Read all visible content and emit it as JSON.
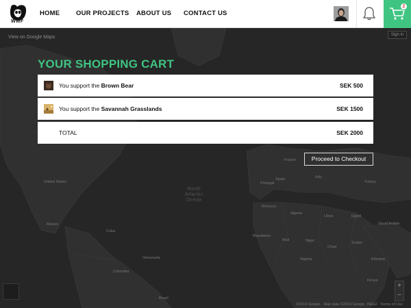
{
  "header": {
    "logo_text": "WWF",
    "nav": [
      {
        "label": "HOME"
      },
      {
        "label": "OUR PROJECTS"
      },
      {
        "label": "ABOUT US"
      },
      {
        "label": "CONTACT US"
      }
    ],
    "cart_count": "2"
  },
  "map": {
    "google_maps_link": "View on Google Maps",
    "sign_in": "Sign in",
    "ocean_label": "North\nAtlantic\nOcean",
    "labels": [
      "United States",
      "Mexico",
      "Cuba",
      "Venezuela",
      "Colombia",
      "Brazil",
      "Portugal",
      "Spain",
      "France",
      "Italy",
      "Turkey",
      "Morocco",
      "Algeria",
      "Libya",
      "Egypt",
      "Saudi Arabia",
      "Mali",
      "Niger",
      "Chad",
      "Sudan",
      "Nigeria",
      "Ethiopia",
      "Kenya",
      "Mauritania"
    ],
    "copyright": "©2014 Google · Map data ©2014 Google, INEGI · Terms of Use",
    "zoom_in": "+",
    "zoom_out": "−"
  },
  "cart": {
    "title": "YOUR SHOPPING CART",
    "items": [
      {
        "prefix": "You support the ",
        "name": "Brown Bear",
        "price": "SEK 500"
      },
      {
        "prefix": "You support the ",
        "name": "Savannah Grasslands",
        "price": "SEK 1500"
      }
    ],
    "total_label": "TOTAL",
    "total_price": "SEK 2000",
    "checkout_label": "Proceed to Checkout"
  },
  "colors": {
    "accent": "#3fc482",
    "badge_text": "#e04646",
    "map_background": "#262626"
  }
}
